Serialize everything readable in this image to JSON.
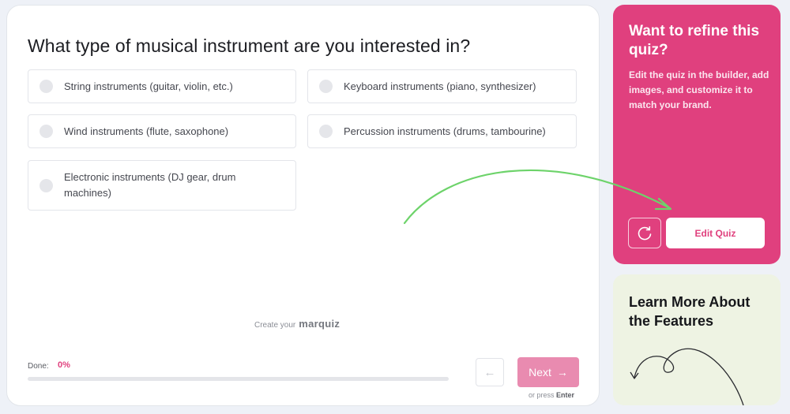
{
  "question": "What type of musical instrument are you interested in?",
  "options": [
    {
      "label": "String instruments (guitar, violin, etc.)"
    },
    {
      "label": "Keyboard instruments (piano, synthesizer)"
    },
    {
      "label": "Wind instruments (flute, saxophone)"
    },
    {
      "label": "Percussion instruments (drums, tambourine)"
    },
    {
      "label": "Electronic instruments (DJ gear, drum machines)"
    }
  ],
  "branding": {
    "prefix": "Create your",
    "name": "marquiz"
  },
  "progress": {
    "label": "Done:",
    "value": "0%",
    "fraction": 0
  },
  "nav": {
    "next_label": "Next",
    "hint_prefix": "or press",
    "hint_key": "Enter"
  },
  "promo": {
    "title": "Want to refine this quiz?",
    "text": "Edit the quiz in the builder, add images, and customize it to match your brand.",
    "edit_label": "Edit Quiz"
  },
  "learn": {
    "title": "Learn More About the Features"
  },
  "colors": {
    "accent": "#e0417e",
    "next_button": "#e98bb0",
    "learn_bg": "#eef3e3",
    "arrow": "#6dd36a"
  }
}
